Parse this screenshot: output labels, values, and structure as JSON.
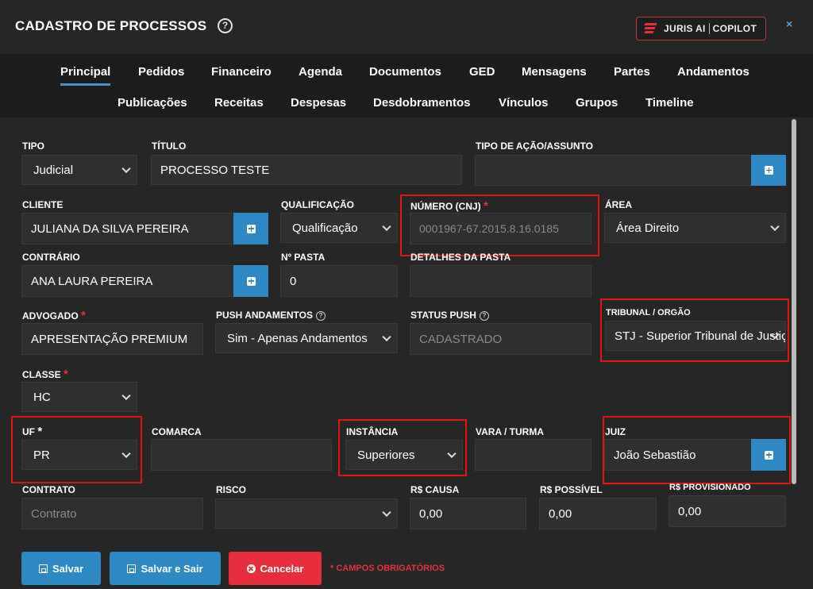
{
  "header": {
    "title": "CADASTRO DE PROCESSOS",
    "help": "?",
    "copilot_brand": "JURIS AI",
    "copilot_label": "COPILOT",
    "close": "×"
  },
  "tabs_row1": [
    "Principal",
    "Pedidos",
    "Financeiro",
    "Agenda",
    "Documentos",
    "GED",
    "Mensagens",
    "Partes",
    "Andamentos"
  ],
  "tabs_row2": [
    "Publicações",
    "Receitas",
    "Despesas",
    "Desdobramentos",
    "Vínculos",
    "Grupos",
    "Timeline"
  ],
  "active_tab": "Principal",
  "form": {
    "tipo": {
      "label": "TIPO",
      "value": "Judicial"
    },
    "titulo": {
      "label": "TÍTULO",
      "value": "PROCESSO TESTE"
    },
    "tipo_acao": {
      "label": "TIPO DE AÇÃO/ASSUNTO",
      "value": ""
    },
    "cliente": {
      "label": "CLIENTE",
      "value": "JULIANA DA SILVA PEREIRA"
    },
    "qualificacao": {
      "label": "QUALIFICAÇÃO",
      "value": "Qualificação"
    },
    "numero": {
      "label": "NÚMERO (CNJ)",
      "value": "0001967-67.2015.8.16.0185"
    },
    "area": {
      "label": "ÁREA",
      "value": "Área Direito"
    },
    "contrario": {
      "label": "CONTRÁRIO",
      "value": "ANA LAURA PEREIRA"
    },
    "pasta": {
      "label": "Nº PASTA",
      "value": "0"
    },
    "detalhes_pasta": {
      "label": "DETALHES DA PASTA",
      "value": ""
    },
    "advogado": {
      "label": "ADVOGADO",
      "value": "APRESENTAÇÃO PREMIUM"
    },
    "push": {
      "label": "PUSH ANDAMENTOS",
      "value": "Sim - Apenas Andamentos"
    },
    "status_push": {
      "label": "STATUS PUSH",
      "value": "CADASTRADO"
    },
    "tribunal": {
      "label": "TRIBUNAL / ORGÃO",
      "value": "STJ - Superior Tribunal de Justiça"
    },
    "classe": {
      "label": "CLASSE",
      "value": "HC"
    },
    "uf": {
      "label": "UF",
      "value": "PR"
    },
    "comarca": {
      "label": "COMARCA",
      "value": ""
    },
    "instancia": {
      "label": "INSTÂNCIA",
      "value": "Superiores"
    },
    "vara": {
      "label": "VARA / TURMA",
      "value": ""
    },
    "juiz": {
      "label": "JUIZ",
      "value": "João Sebastião"
    },
    "contrato": {
      "label": "CONTRATO",
      "placeholder": "Contrato"
    },
    "risco": {
      "label": "RISCO",
      "value": ""
    },
    "causa": {
      "label": "R$ CAUSA",
      "value": "0,00"
    },
    "possivel": {
      "label": "R$ POSSÍVEL",
      "value": "0,00"
    },
    "provisionado": {
      "label": "R$ PROVISIONADO",
      "value": "0,00"
    }
  },
  "required_mark": "*",
  "status_help": "?",
  "buttons": {
    "save": "Salvar",
    "save_exit": "Salvar e Sair",
    "cancel": "Cancelar"
  },
  "required_note": "* CAMPOS OBRIGATÓRIOS",
  "colors": {
    "accent": "#2e88c4",
    "danger": "#e82e3c",
    "highlight": "#e11414",
    "background": "#262626"
  }
}
